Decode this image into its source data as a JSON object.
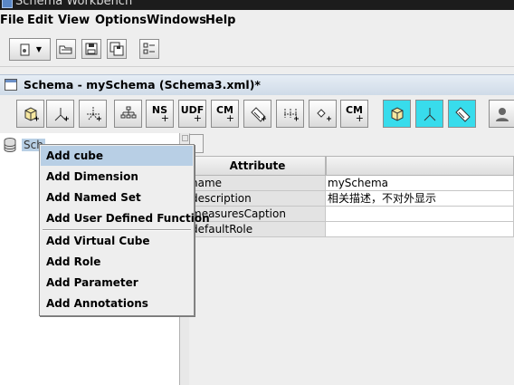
{
  "window": {
    "title": "Schema Workbench"
  },
  "menubar": {
    "items": [
      "File",
      "Edit",
      "View",
      "Options",
      "Windows",
      "Help"
    ]
  },
  "app_toolbar": {
    "icons": [
      "new-dropdown-icon",
      "open-icon",
      "save-icon",
      "save-as-icon",
      "preferences-icon"
    ]
  },
  "frame": {
    "title": "Schema - mySchema (Schema3.xml)*"
  },
  "schema_toolbar": {
    "buttons": [
      {
        "icon": "add-cube-icon",
        "label": ""
      },
      {
        "icon": "add-dimension-icon",
        "label": ""
      },
      {
        "icon": "add-hierarchy-icon",
        "label": ""
      },
      {
        "icon": "add-level-icon",
        "label": ""
      },
      {
        "icon": "add-named-set-icon",
        "label": "NS"
      },
      {
        "icon": "add-udf-icon",
        "label": "UDF"
      },
      {
        "icon": "add-calculated-member-icon",
        "label": "CM"
      },
      {
        "icon": "add-measure-icon",
        "label": ""
      },
      {
        "icon": "add-property-icon",
        "label": ""
      },
      {
        "icon": "add-parameter-icon",
        "label": ""
      },
      {
        "icon": "add-cm-item-icon",
        "label": "CM"
      },
      {
        "icon": "add-virtual-cube-icon",
        "label": ""
      },
      {
        "icon": "add-virtual-dimension-icon",
        "label": ""
      },
      {
        "icon": "add-virtual-measure-icon",
        "label": ""
      },
      {
        "icon": "add-role-icon",
        "label": ""
      }
    ]
  },
  "tree": {
    "root_label": "Sch"
  },
  "attributes": {
    "header": "Attribute",
    "rows": [
      {
        "name": "name",
        "value": "mySchema"
      },
      {
        "name": "description",
        "value": "相关描述，不对外显示"
      },
      {
        "name": "measuresCaption",
        "value": ""
      },
      {
        "name": "defaultRole",
        "value": ""
      }
    ]
  },
  "context_menu": {
    "selected_index": 0,
    "items": [
      "Add cube",
      "Add Dimension",
      "Add Named Set",
      "Add User Defined Function",
      "Add Virtual Cube",
      "Add Role",
      "Add Parameter",
      "Add Annotations"
    ]
  },
  "colors": {
    "selection": "#b8cfe5",
    "cyan_button": "#38dcec"
  }
}
